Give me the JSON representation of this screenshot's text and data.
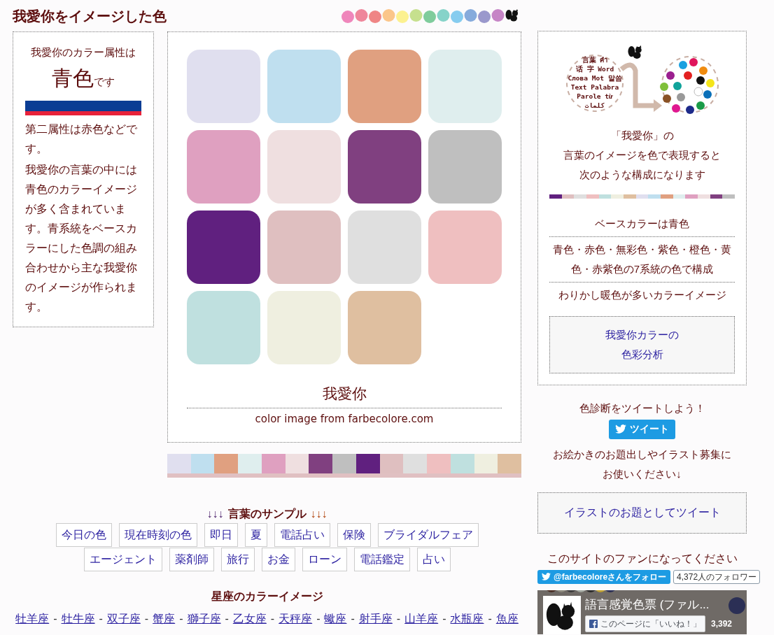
{
  "header": {
    "title": "我愛你をイメージした色"
  },
  "attribute_panel": {
    "intro": "我愛你のカラー属性は",
    "main_color": "青色",
    "suffix": "です",
    "bar": [
      {
        "color": "#0b3d94"
      },
      {
        "color": "#e8223a"
      }
    ],
    "paragraphs": [
      "第二属性は赤色などです。",
      "我愛你の言葉の中には青色のカラーイメージが多く含まれています。青系統をベースカラーにした色調の組み合わせから主な我愛你のイメージが作られます。"
    ]
  },
  "palette": {
    "swatches": [
      {
        "color": "#e0dfef"
      },
      {
        "color": "#bfdfef"
      },
      {
        "color": "#e0a080"
      },
      {
        "color": "#dfeeee"
      },
      {
        "color": "#dfa0c0"
      },
      {
        "color": "#efdfe0"
      },
      {
        "color": "#804080"
      },
      {
        "color": "#bfbfbf"
      },
      {
        "color": "#60207f"
      },
      {
        "color": "#dfbfc0"
      },
      {
        "color": "#dfdfdf"
      },
      {
        "color": "#efbfc0"
      },
      {
        "color": "#bfe0df"
      },
      {
        "color": "#efefe0"
      },
      {
        "color": "#dfbfa0"
      }
    ],
    "word": "我愛你",
    "credit": "color image from farbecolore.com"
  },
  "samples": {
    "arrows_left": "↓↓↓",
    "title": "言葉のサンプル",
    "arrows_right": "↓↓↓",
    "rows": [
      [
        "今日の色",
        "現在時刻の色",
        "即日",
        "夏",
        "電話占い",
        "保険",
        "ブライダルフェア"
      ],
      [
        "エージェント",
        "薬剤師",
        "旅行",
        "お金",
        "ローン",
        "電話鑑定",
        "占い"
      ]
    ]
  },
  "zodiac": {
    "title": "星座のカラーイメージ",
    "links": [
      {
        "label": "牡羊座",
        "separator": "-"
      },
      {
        "label": "牡牛座",
        "separator": "-"
      },
      {
        "label": "双子座",
        "separator": "-"
      },
      {
        "label": "蟹座",
        "separator": "-"
      },
      {
        "label": "獅子座",
        "separator": "-"
      },
      {
        "label": "乙女座",
        "separator": "-"
      },
      {
        "label": "天秤座",
        "separator": "-"
      },
      {
        "label": "蠍座",
        "separator": "-"
      },
      {
        "label": "射手座",
        "separator": "-"
      },
      {
        "label": "山羊座",
        "separator": "-"
      },
      {
        "label": "水瓶座",
        "separator": "-"
      },
      {
        "label": "魚座"
      }
    ]
  },
  "analysis_panel": {
    "illustration_words": [
      [
        "言葉",
        "คำ"
      ],
      [
        "话",
        "字",
        "Word"
      ],
      [
        "Слова",
        "Mot",
        "말씀"
      ],
      [
        "Text",
        "Palabra"
      ],
      [
        "Parole",
        "từ"
      ],
      [
        "كلمات"
      ]
    ],
    "caption_lines": [
      "「我愛你」の",
      "言葉のイメージを色で表現すると",
      "次のような構成になります"
    ],
    "strip": [
      {
        "color": "#60207f"
      },
      {
        "color": "#dfbfc0"
      },
      {
        "color": "#dfdfdf"
      },
      {
        "color": "#efbfc0"
      },
      {
        "color": "#bfe0df"
      },
      {
        "color": "#efefe0"
      },
      {
        "color": "#dfbfa0"
      },
      {
        "color": "#e0dfef"
      },
      {
        "color": "#bfdfef"
      },
      {
        "color": "#e0a080"
      },
      {
        "color": "#dfeeee"
      },
      {
        "color": "#dfa0c0"
      },
      {
        "color": "#efdfe0"
      },
      {
        "color": "#804080"
      },
      {
        "color": "#bfbfbf"
      }
    ],
    "facts": [
      "ベースカラーは青色",
      "青色・赤色・無彩色・紫色・橙色・黄色・赤紫色の7系統の色で構成",
      "わりかし暖色が多いカラーイメージ"
    ],
    "link_lines": [
      "我愛你カラーの",
      "色彩分析"
    ]
  },
  "share": {
    "tweet_prompt": "色診断をツイートしよう！",
    "tweet_button": "ツイート",
    "illust_lines": [
      "お絵かきのお題出しやイラスト募集に",
      "お使いください↓"
    ],
    "illust_button": "イラストのお題としてツイート",
    "fan_text": "このサイトのファンになってください",
    "follow_button": "@farbecoloreさんをフォロー",
    "follower_count": "4,372人のフォロワー",
    "fb_title": "語言感覚色票 (ファル...",
    "fb_like": "このページに「いいね！」",
    "fb_count": "3,392"
  }
}
